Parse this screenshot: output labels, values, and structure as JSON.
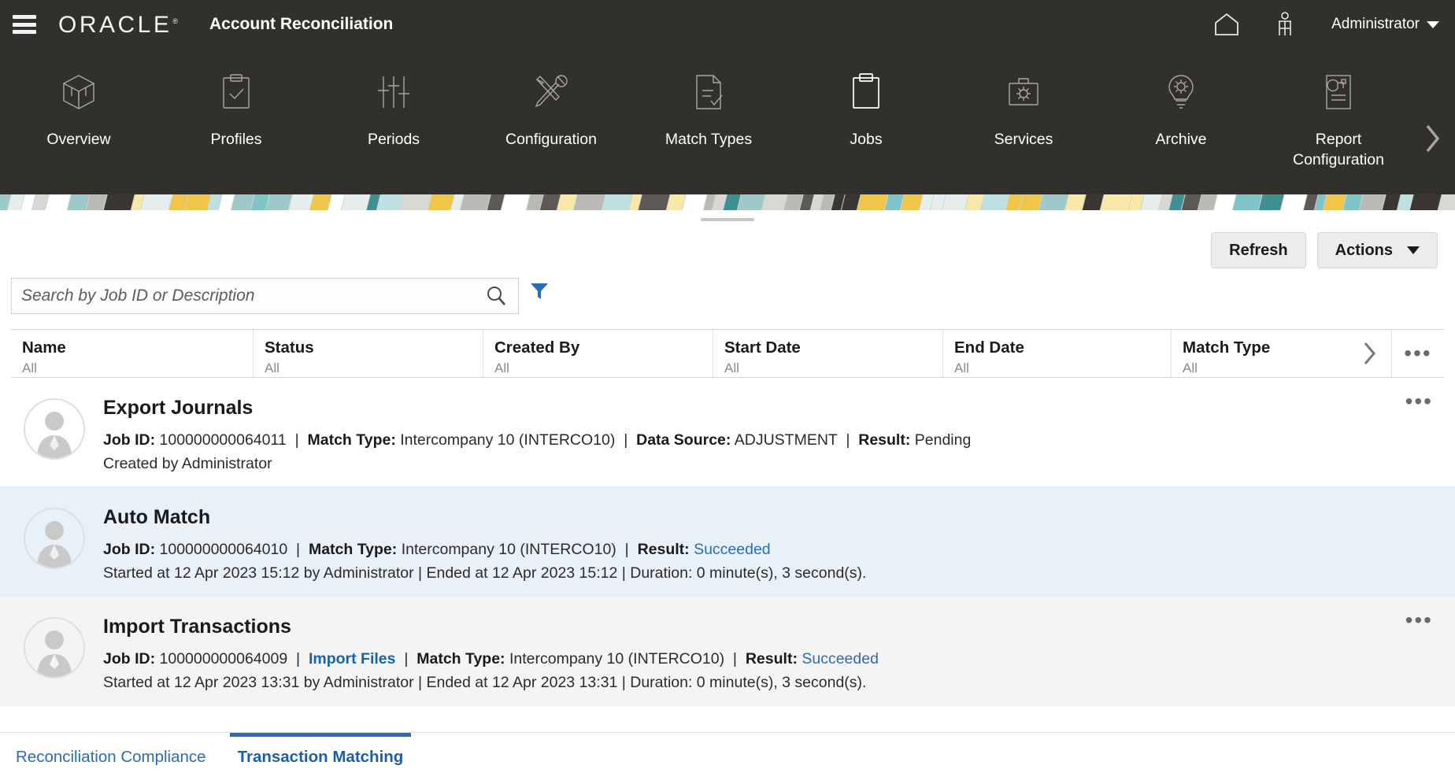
{
  "header": {
    "menu_icon": "hamburger-icon",
    "brand": "ORACLE",
    "app_title": "Account Reconciliation",
    "home_icon": "home-icon",
    "accessibility_icon": "accessibility-icon",
    "user_label": "Administrator"
  },
  "nav": {
    "items": [
      {
        "label": "Overview",
        "icon": "cube-icon",
        "active": false
      },
      {
        "label": "Profiles",
        "icon": "clipboard-check-icon",
        "active": false
      },
      {
        "label": "Periods",
        "icon": "sliders-icon",
        "active": false
      },
      {
        "label": "Configuration",
        "icon": "tools-icon",
        "active": false
      },
      {
        "label": "Match Types",
        "icon": "document-check-icon",
        "active": false
      },
      {
        "label": "Jobs",
        "icon": "clipboard-icon",
        "active": true
      },
      {
        "label": "Services",
        "icon": "toolbox-icon",
        "active": false
      },
      {
        "label": "Archive",
        "icon": "lightbulb-icon",
        "active": false
      },
      {
        "label": "Report Configuration",
        "icon": "report-chart-icon",
        "active": false
      }
    ],
    "next_icon": "chevron-right-icon"
  },
  "toolbar": {
    "refresh_label": "Refresh",
    "actions_label": "Actions"
  },
  "search": {
    "placeholder": "Search by Job ID or Description",
    "value": "",
    "search_icon": "search-icon",
    "filter_icon": "filter-icon",
    "filter_color": "#2b6cb5"
  },
  "table": {
    "columns": [
      {
        "header": "Name",
        "filter": "All"
      },
      {
        "header": "Status",
        "filter": "All"
      },
      {
        "header": "Created By",
        "filter": "All"
      },
      {
        "header": "Start Date",
        "filter": "All"
      },
      {
        "header": "End Date",
        "filter": "All"
      },
      {
        "header": "Match Type",
        "filter": "All"
      }
    ],
    "expand_icon": "chevron-right-icon",
    "overflow_icon": "more-horizontal-icon"
  },
  "jobs": [
    {
      "title": "Export Journals",
      "highlight": "white",
      "meta": [
        {
          "label": "Job ID:",
          "value": "100000000064011",
          "type": "text"
        },
        {
          "label": "Match Type:",
          "value": "Intercompany 10 (INTERCO10)",
          "type": "text"
        },
        {
          "label": "Data Source:",
          "value": "ADJUSTMENT",
          "type": "text"
        },
        {
          "label": "Result:",
          "value": "Pending",
          "type": "text"
        }
      ],
      "subline": "Created by Administrator",
      "avatar_icon": "user-avatar-icon",
      "row_menu_icon": "more-horizontal-icon"
    },
    {
      "title": "Auto Match",
      "highlight": "blue",
      "meta": [
        {
          "label": "Job ID:",
          "value": "100000000064010",
          "type": "text"
        },
        {
          "label": "Match Type:",
          "value": "Intercompany 10 (INTERCO10)",
          "type": "text"
        },
        {
          "label": "Result:",
          "value": "Succeeded",
          "type": "link"
        }
      ],
      "subline": "Started at 12 Apr 2023 15:12 by Administrator  | Ended at 12 Apr 2023 15:12 | Duration: 0 minute(s), 3 second(s).",
      "avatar_icon": "user-avatar-icon",
      "row_menu_icon": null
    },
    {
      "title": "Import Transactions",
      "highlight": "gray",
      "meta": [
        {
          "label": "Job ID:",
          "value": "100000000064009",
          "type": "text"
        },
        {
          "label": "",
          "value": "Import Files",
          "type": "boldlink"
        },
        {
          "label": "Match Type:",
          "value": "Intercompany 10 (INTERCO10)",
          "type": "text"
        },
        {
          "label": "Result:",
          "value": "Succeeded",
          "type": "link"
        }
      ],
      "subline": "Started at 12 Apr 2023 13:31 by Administrator  | Ended at 12 Apr 2023 13:31 | Duration: 0 minute(s), 3 second(s).",
      "avatar_icon": "user-avatar-icon",
      "row_menu_icon": "more-horizontal-icon"
    }
  ],
  "tabs": [
    {
      "label": "Reconciliation Compliance",
      "active": false
    },
    {
      "label": "Transaction Matching",
      "active": true
    }
  ],
  "colors": {
    "header_bg": "#32302d",
    "link": "#2b6cb5",
    "selected_row": "#e8f1f8",
    "accent": "#2b6cb5"
  }
}
